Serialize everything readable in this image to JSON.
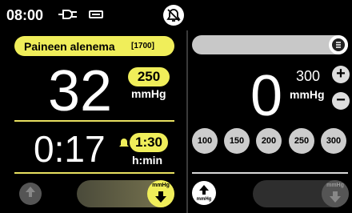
{
  "status": {
    "time": "08:00"
  },
  "left": {
    "alert": {
      "text": "Paineen alenema",
      "code": "[1700]"
    },
    "pressure_value": "32",
    "setpoint": {
      "value": "250",
      "unit": "mmHg"
    },
    "timer": {
      "value": "0:17",
      "set": "1:30",
      "unit": "h:min"
    },
    "deflate_knob_unit": "mmHg",
    "inflate_button_unit": "mmHg"
  },
  "right": {
    "pressure_value": "0",
    "setpoint": {
      "value": "300",
      "unit": "mmHg"
    },
    "plus": "+",
    "minus": "−",
    "presets": [
      "100",
      "150",
      "200",
      "250",
      "300"
    ],
    "inflate_button_unit": "mmHg",
    "deflate_knob_unit": "mmHg"
  },
  "colors": {
    "accent_yellow": "#f0ee5a",
    "background": "#000000"
  }
}
